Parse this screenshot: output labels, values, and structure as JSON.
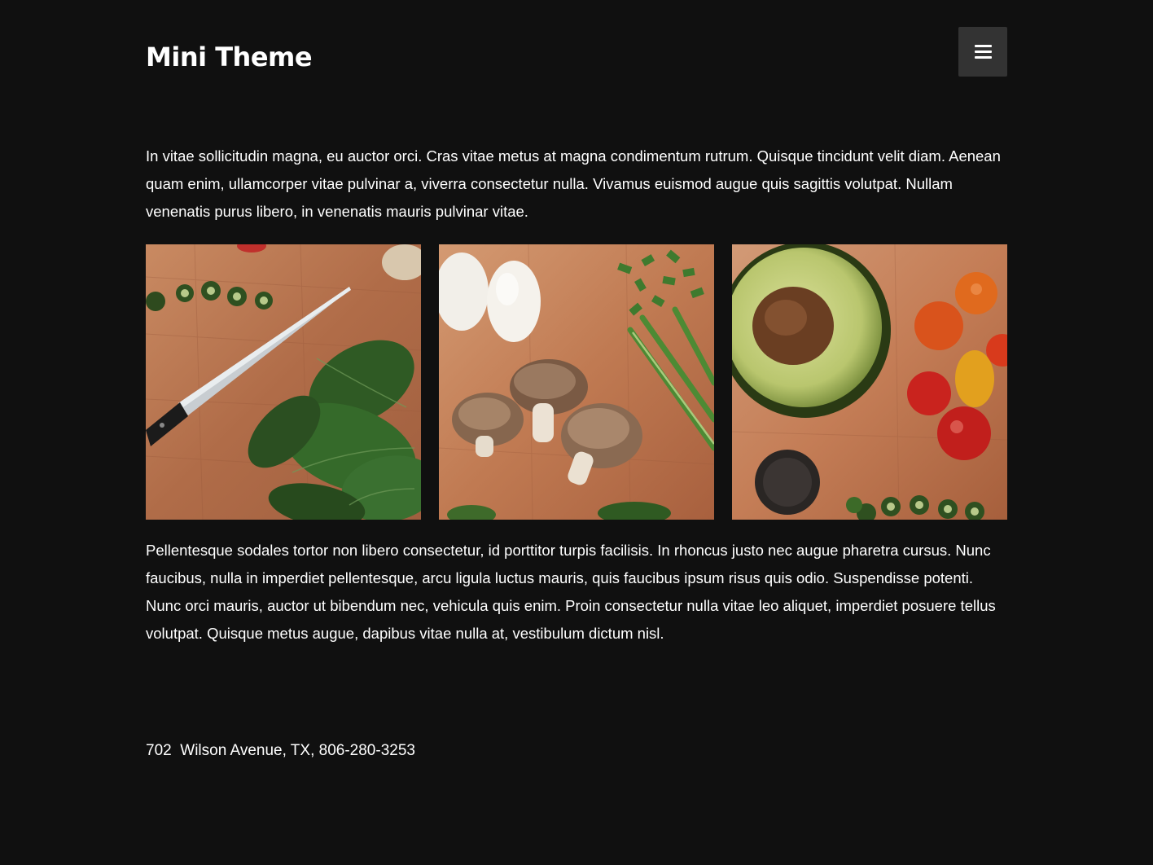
{
  "header": {
    "site_title": "Mini Theme",
    "menu_icon": "hamburger-menu-icon"
  },
  "content": {
    "intro": "In vitae sollicitudin magna, eu auctor orci. Cras vitae metus at magna condimentum rutrum. Quisque tincidunt velit diam. Aenean quam enim, ullamcorper vitae pulvinar a, viverra consectetur nulla. Vivamus euismod augue quis sagittis volutpat. Nullam venenatis purus libero, in venenatis mauris pulvinar vitae.",
    "body": "Pellentesque sodales tortor non libero consectetur, id porttitor turpis facilisis. In rhoncus justo nec augue pharetra cursus. Nunc faucibus, nulla in imperdiet pellentesque, arcu ligula luctus mauris, quis faucibus ipsum risus quis odio. Suspendisse potenti. Nunc orci mauris, auctor ut bibendum nec, vehicula quis enim. Proin consectetur nulla vitae leo aliquet, imperdiet posuere tellus volutpat. Quisque metus augue, dapibus vitae nulla at, vestibulum dictum nisl."
  },
  "footer": {
    "address": "702  Wilson Avenue, TX, 806-280-3253"
  },
  "colors": {
    "background": "#101010",
    "text": "#ffffff",
    "menu_button": "#333333"
  }
}
